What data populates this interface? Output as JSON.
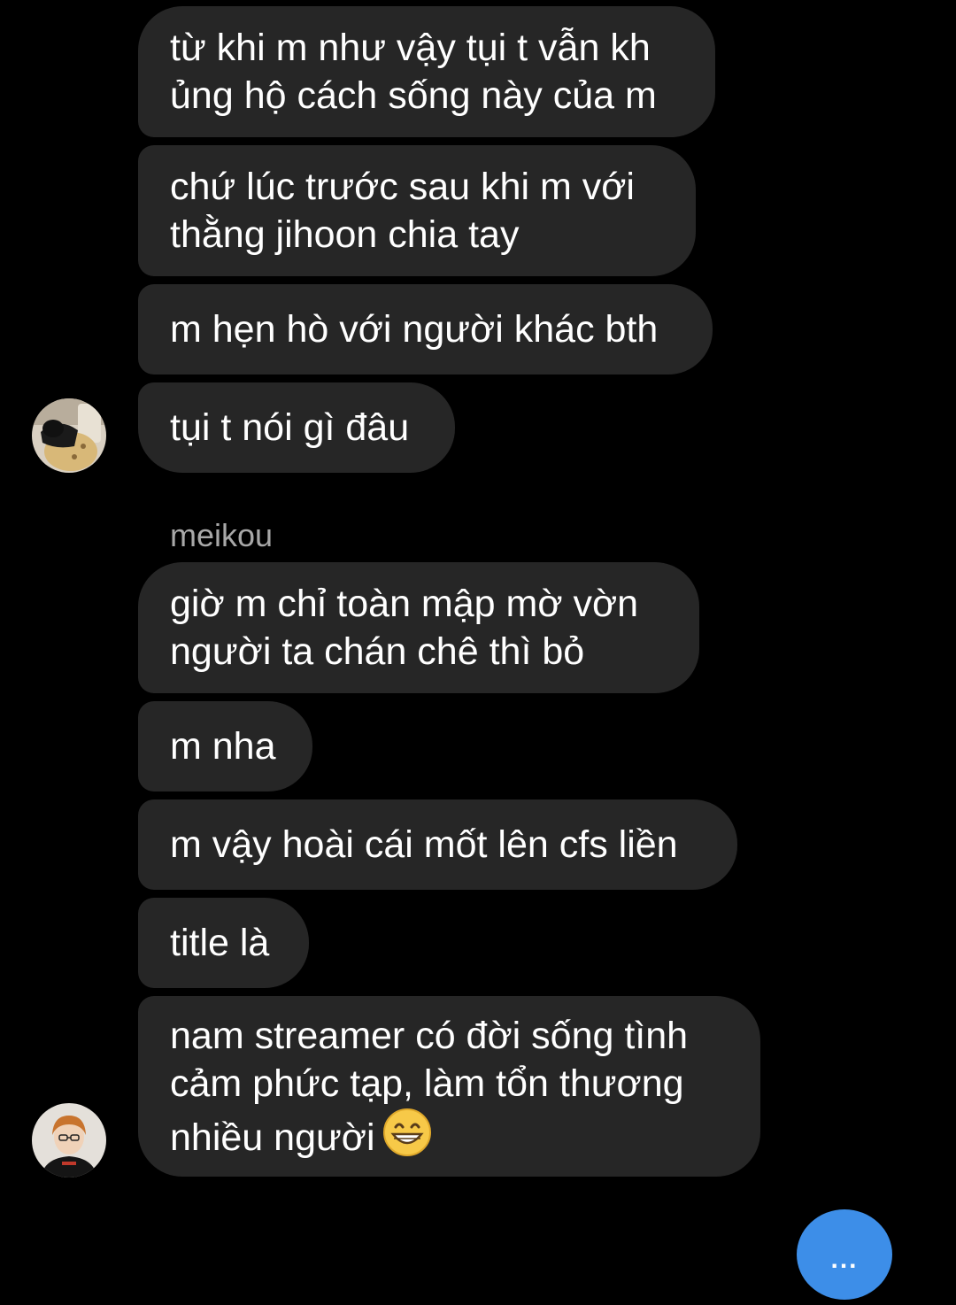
{
  "messages": [
    {
      "id": "b1",
      "text": "từ khi m như vậy tụi t vẫn kh\nủng hộ cách sống này của m"
    },
    {
      "id": "b2",
      "text": "chứ lúc trước sau khi m với\nthằng jihoon chia tay"
    },
    {
      "id": "b3",
      "text": "m hẹn hò với người khác bth"
    },
    {
      "id": "b4",
      "text": "tụi t nói gì đâu"
    },
    {
      "id": "b5",
      "text": "giờ m chỉ toàn mập mờ vờn\nngười ta chán chê thì bỏ"
    },
    {
      "id": "b6",
      "text": "m nha"
    },
    {
      "id": "b7",
      "text": "m vậy hoài cái mốt lên cfs liền"
    },
    {
      "id": "b8",
      "text": "title là"
    },
    {
      "id": "b9",
      "text": "nam streamer có đời sống tình\ncảm phức tạp, làm tổn thương\nnhiều người",
      "emoji": "grinning-face-emoji"
    }
  ],
  "sender_name": "meikou",
  "typing_indicator": "...",
  "colors": {
    "background": "#000000",
    "bubble": "#262626",
    "text": "#ffffff",
    "sender_name": "#a8a8a8",
    "typing_button": "#3d8ee8"
  },
  "icons": {
    "avatar_1": "avatar-photo",
    "avatar_2": "avatar-photo",
    "emoji": "grinning-face-emoji"
  }
}
